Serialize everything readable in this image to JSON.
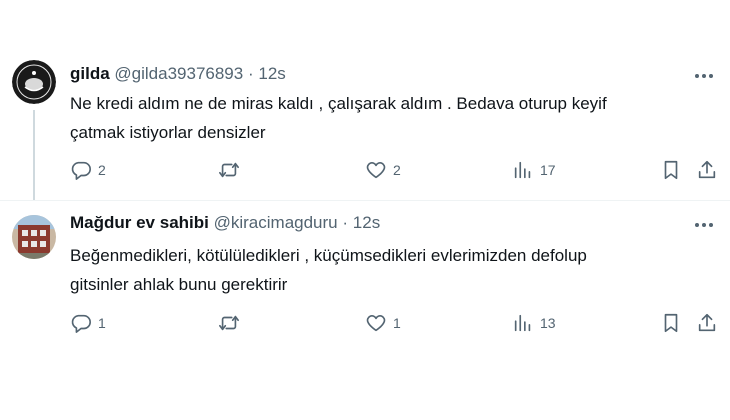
{
  "tweets": [
    {
      "display_name": "gilda",
      "handle": "@gilda39376893",
      "separator": "·",
      "time": "12s",
      "text_line1": "Ne kredi aldım ne de miras kaldı , çalışarak aldım . Bedava oturup keyif",
      "text_line2": "çatmak istiyorlar densizler",
      "replies": "2",
      "retweets": "",
      "likes": "2",
      "views": "17"
    },
    {
      "display_name": "Mağdur ev sahibi",
      "handle": "@kiracimagduru",
      "separator": "·",
      "time": "12s",
      "text_line1": "Beğenmedikleri,  kötülüledikleri , küçümsedikleri evlerimizden defolup",
      "text_line2": "gitsinler ahlak bunu gerektirir",
      "replies": "1",
      "retweets": "",
      "likes": "1",
      "views": "13"
    }
  ],
  "colors": {
    "text": "#0f1419",
    "muted": "#536471",
    "line": "#cfd9de"
  }
}
